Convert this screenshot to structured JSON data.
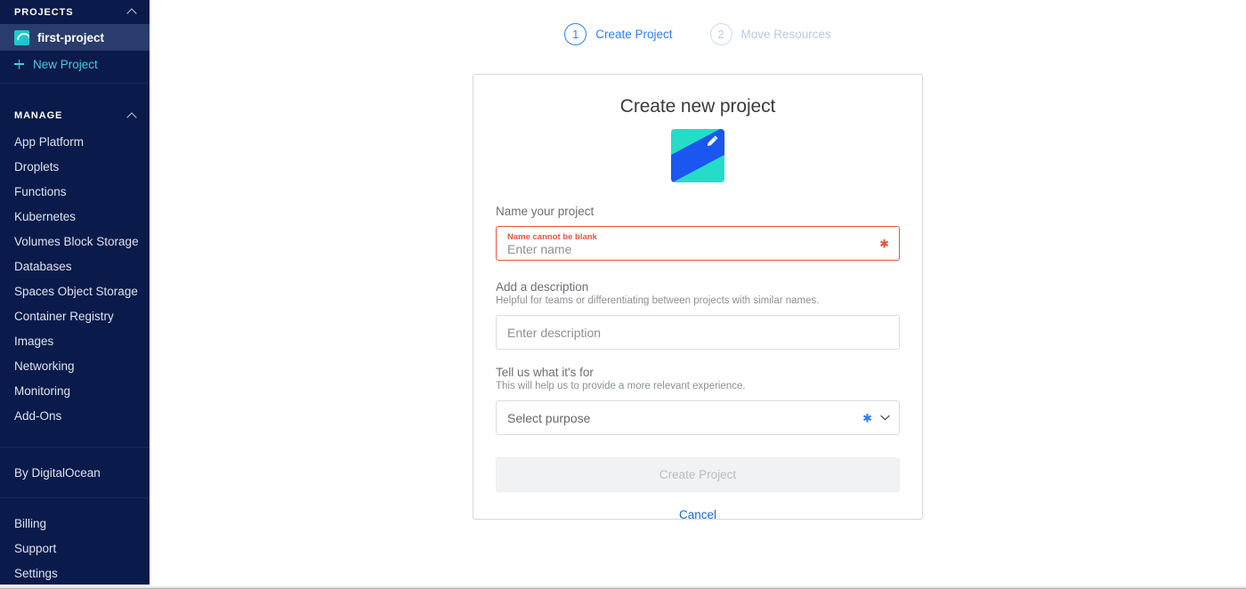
{
  "sidebar": {
    "projects_header": {
      "label": "PROJECTS",
      "collapse_icon": "chevron-up-icon"
    },
    "active_project": {
      "label": "first-project",
      "avatar_icon": "project-avatar-icon"
    },
    "new_project": {
      "label": "New Project",
      "icon": "plus-icon",
      "color": "#3ecfdc"
    },
    "manage_header": {
      "label": "MANAGE",
      "collapse_icon": "chevron-up-icon"
    },
    "manage_items": [
      {
        "label": "App Platform"
      },
      {
        "label": "Droplets"
      },
      {
        "label": "Functions"
      },
      {
        "label": "Kubernetes"
      },
      {
        "label": "Volumes Block Storage"
      },
      {
        "label": "Databases"
      },
      {
        "label": "Spaces Object Storage"
      },
      {
        "label": "Container Registry"
      },
      {
        "label": "Images"
      },
      {
        "label": "Networking"
      },
      {
        "label": "Monitoring"
      },
      {
        "label": "Add-Ons"
      }
    ],
    "by_digitalocean": {
      "label": "By DigitalOcean"
    },
    "footer_items": [
      {
        "label": "Billing"
      },
      {
        "label": "Support"
      },
      {
        "label": "Settings"
      }
    ],
    "background_color": "#0a1a4a",
    "active_row_color": "#2a3c6b"
  },
  "stepper": {
    "steps": [
      {
        "number": "1",
        "label": "Create Project",
        "state": "active"
      },
      {
        "number": "2",
        "label": "Move Resources",
        "state": "inactive"
      }
    ],
    "active_color": "#2d7ff9",
    "inactive_color": "#bac9e4"
  },
  "card": {
    "title": "Create new project",
    "project_image": {
      "icon": "project-image-icon",
      "edit_icon": "pencil-icon",
      "base_color": "#25dcc9",
      "band_color": "#1b56f0"
    },
    "name_field": {
      "label": "Name your project",
      "error": "Name cannot be blank",
      "placeholder": "Enter name",
      "value": "",
      "required_marker": "✱",
      "error_color": "#e8553d"
    },
    "description_field": {
      "label": "Add a description",
      "hint": "Helpful for teams or differentiating between projects with similar names.",
      "placeholder": "Enter description",
      "value": ""
    },
    "purpose_field": {
      "label": "Tell us what it's for",
      "hint": "This will help us to provide a more relevant experience.",
      "placeholder": "Select purpose",
      "value": "",
      "required_marker": "✱",
      "required_color": "#2d7ff9",
      "chevron_icon": "chevron-down-icon"
    },
    "submit_button": {
      "label": "Create Project",
      "disabled": true
    }
  },
  "cancel_link": {
    "label": "Cancel",
    "color": "#1a66d4"
  }
}
